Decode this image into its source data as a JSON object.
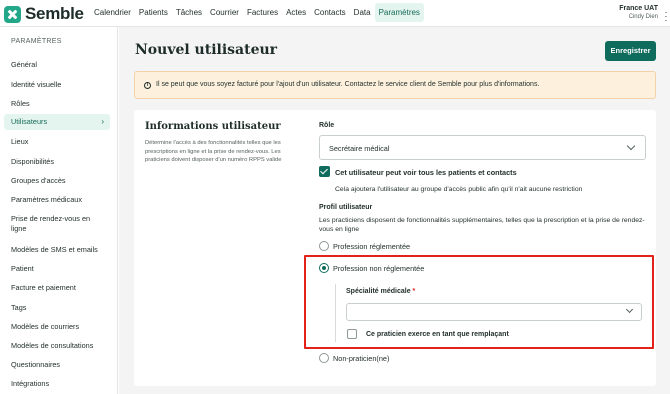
{
  "app": {
    "name": "Semble"
  },
  "nav": {
    "items": [
      "Calendrier",
      "Patients",
      "Tâches",
      "Courrier",
      "Factures",
      "Actes",
      "Contacts",
      "Data",
      "Paramètres"
    ],
    "active": "Paramètres"
  },
  "org": {
    "name": "France UAT",
    "user": "Cindy Dien"
  },
  "sidebar": {
    "heading": "PARAMÈTRES",
    "items": [
      {
        "label": "Général"
      },
      {
        "label": "Identité visuelle"
      },
      {
        "label": "Rôles"
      },
      {
        "label": "Utilisateurs",
        "active": true
      },
      {
        "label": "Lieux"
      },
      {
        "label": "Disponibilités"
      },
      {
        "label": "Groupes d'accès"
      },
      {
        "label": "Paramètres médicaux"
      },
      {
        "label": "Prise de rendez-vous en ligne"
      },
      {
        "label": "Modèles de SMS et emails"
      },
      {
        "label": "Patient"
      },
      {
        "label": "Facture et paiement"
      },
      {
        "label": "Tags"
      },
      {
        "label": "Modèles de courriers"
      },
      {
        "label": "Modèles de consultations"
      },
      {
        "label": "Questionnaires"
      },
      {
        "label": "Intégrations"
      }
    ]
  },
  "page": {
    "title": "Nouvel utilisateur",
    "save_label": "Enregistrer"
  },
  "notice": {
    "icon": "info-icon",
    "text": "Il se peut que vous soyez facturé pour l'ajout d'un utilisateur. Contactez le service client de Semble pour plus d'informations."
  },
  "form": {
    "section_title": "Informations utilisateur",
    "section_desc": "Détermine l'accès à des fonctionnalités telles que les prescriptions en ligne et la prise de rendez-vous. Les praticiens doivent disposer d'un numéro RPPS valide",
    "role_label": "Rôle",
    "role_value": "Secrétaire médical",
    "see_all_label": "Cet utilisateur peut voir tous les patients et contacts",
    "see_all_checked": true,
    "see_all_desc": "Cela ajoutera l'utilisateur au groupe d'accès public afin qu'il n'ait aucune restriction",
    "profile_label": "Profil utilisateur",
    "profile_desc": "Les practiciens disposent de fonctionnalités supplémentaires, telles que la prescription et la prise de rendez-vous en ligne",
    "profiles": [
      {
        "label": "Profession réglementée",
        "selected": false
      },
      {
        "label": "Profession non réglementée",
        "selected": true
      },
      {
        "label": "Non-praticien(ne)",
        "selected": false
      }
    ],
    "specialty_label": "Spécialité médicale",
    "specialty_required": "*",
    "specialty_value": "",
    "replacement_label": "Ce praticien exerce en tant que remplaçant",
    "replacement_checked": false
  },
  "colors": {
    "accent": "#0f6b5c",
    "brand": "#22a789",
    "highlight": "#e3231a",
    "notice_bg": "#fdf0dc"
  }
}
